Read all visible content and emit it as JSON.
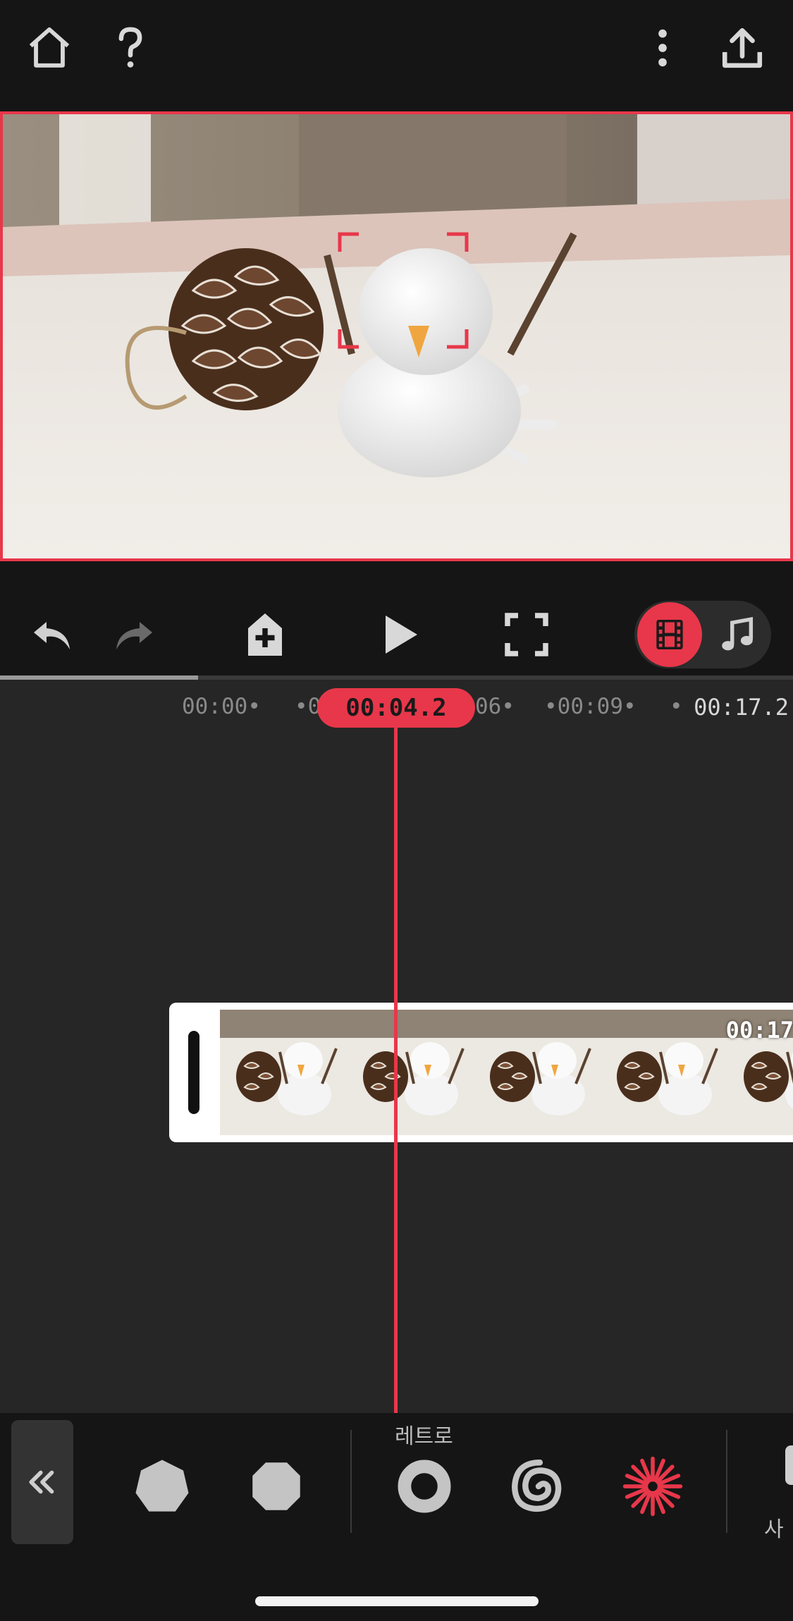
{
  "app": {
    "toolbar": {
      "home_icon": "home-icon",
      "help_icon": "help-icon",
      "more_icon": "more-vertical-icon",
      "export_icon": "share-upload-icon"
    },
    "transport": {
      "undo_icon": "undo-icon",
      "redo_icon": "redo-icon",
      "add_keyframe_icon": "add-keyframe-icon",
      "play_icon": "play-icon",
      "fullscreen_icon": "fullscreen-icon",
      "mode_video_icon": "film-icon",
      "mode_audio_icon": "music-note-icon",
      "active_mode": "video",
      "progress": 0.25
    },
    "timeline": {
      "ticks": [
        "00:00•",
        "•0",
        "06•",
        "•00:09•",
        "•"
      ],
      "playhead": "00:04.2",
      "end_time": "00:17.2",
      "clip_duration": "00:17",
      "thumbnail_count": 5
    },
    "effects": {
      "group_label": "레트로",
      "collapse_icon": "double-chevron-left-icon",
      "items": [
        {
          "icon": "heptagon-icon",
          "active": false
        },
        {
          "icon": "octagon-icon",
          "active": false
        },
        {
          "icon": "ring-icon",
          "active": false
        },
        {
          "icon": "spiral-icon",
          "active": false
        },
        {
          "icon": "starburst-icon",
          "active": true
        }
      ],
      "next_group_label": "사",
      "accent_color": "#e8374a"
    }
  }
}
